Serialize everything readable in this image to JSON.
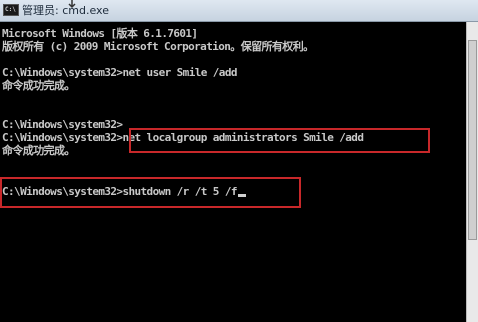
{
  "window": {
    "title": "管理员: cmd.exe",
    "icon_label": "C:\\"
  },
  "console": {
    "lines": [
      "Microsoft Windows [版本 6.1.7601]",
      "版权所有 (c) 2009 Microsoft Corporation。保留所有权利。",
      "",
      "C:\\Windows\\system32>net user Smile /add",
      "命令成功完成。",
      "",
      "",
      "C:\\Windows\\system32>",
      "C:\\Windows\\system32>net localgroup administrators Smile /add",
      "命令成功完成。",
      "",
      "",
      "C:\\Windows\\system32>shutdown /r /t 5 /f"
    ]
  },
  "colors": {
    "console_background": "#000000",
    "console_text": "#c8c8c8",
    "highlight_border": "#c8282a"
  }
}
